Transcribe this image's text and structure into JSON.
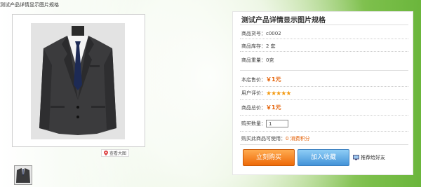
{
  "page_title": "测试产品详情显示图片规格",
  "gallery": {
    "zoom_label": "查看大图"
  },
  "product": {
    "title": "测试产品详情显示图片规格",
    "sku_label": "商品货号：",
    "sku_value": "c0002",
    "stock_label": "商品库存：",
    "stock_value": "2 套",
    "weight_label": "商品重量：",
    "weight_value": "0克",
    "price_label": "本店售价：",
    "price_value": "￥1元",
    "rating_label": "用户评价：",
    "rating_value": 5,
    "rating_max": 5,
    "total_label": "商品总价：",
    "total_value": "￥1元",
    "qty_label": "购买数量：",
    "qty_value": "1",
    "points_text": "购买此商品可使用：",
    "points_value": "0 消费积分"
  },
  "actions": {
    "buy_label": "立刻购买",
    "fav_label": "加入收藏",
    "share_label": "推荐给好友"
  },
  "colors": {
    "price": "#e35d00",
    "buy_button": "#ee6a08",
    "fav_button": "#4393d8",
    "star": "#f39a12"
  }
}
